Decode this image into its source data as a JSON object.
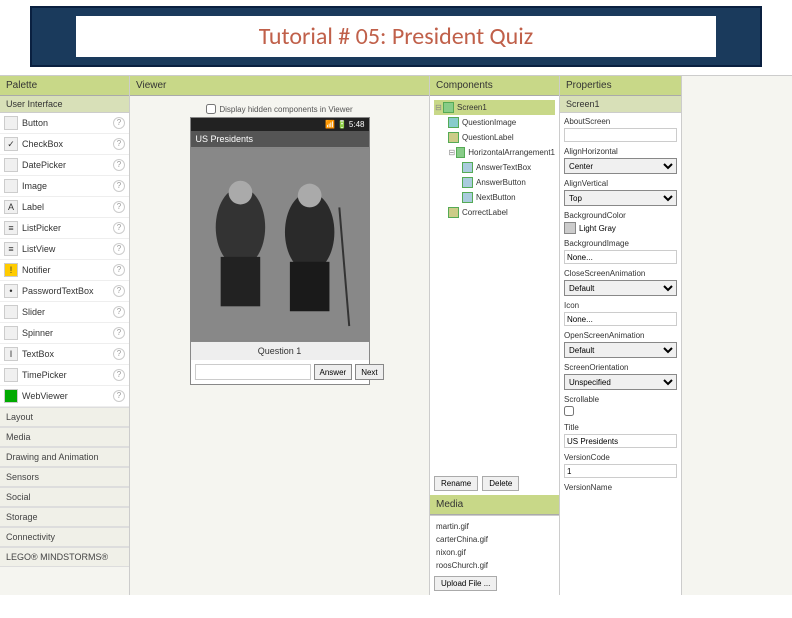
{
  "title": "Tutorial # 05:  President Quiz",
  "palette": {
    "header": "Palette",
    "subheader": "User Interface",
    "items": [
      {
        "label": "Button"
      },
      {
        "label": "CheckBox"
      },
      {
        "label": "DatePicker"
      },
      {
        "label": "Image"
      },
      {
        "label": "Label"
      },
      {
        "label": "ListPicker"
      },
      {
        "label": "ListView"
      },
      {
        "label": "Notifier"
      },
      {
        "label": "PasswordTextBox"
      },
      {
        "label": "Slider"
      },
      {
        "label": "Spinner"
      },
      {
        "label": "TextBox"
      },
      {
        "label": "TimePicker"
      },
      {
        "label": "WebViewer"
      }
    ],
    "categories": [
      "Layout",
      "Media",
      "Drawing and Animation",
      "Sensors",
      "Social",
      "Storage",
      "Connectivity",
      "LEGO® MINDSTORMS®"
    ]
  },
  "viewer": {
    "header": "Viewer",
    "checkbox": "Display hidden components in Viewer",
    "phone_time": "5:48",
    "app_title": "US Presidents",
    "question": "Question 1",
    "answer_btn": "Answer",
    "next_btn": "Next"
  },
  "components": {
    "header": "Components",
    "tree": [
      {
        "label": "Screen1",
        "level": 0,
        "tog": "⊟"
      },
      {
        "label": "QuestionImage",
        "level": 1
      },
      {
        "label": "QuestionLabel",
        "level": 1
      },
      {
        "label": "HorizontalArrangement1",
        "level": 1,
        "tog": "⊟"
      },
      {
        "label": "AnswerTextBox",
        "level": 2
      },
      {
        "label": "AnswerButton",
        "level": 2
      },
      {
        "label": "NextButton",
        "level": 2
      },
      {
        "label": "CorrectLabel",
        "level": 1
      }
    ],
    "rename": "Rename",
    "delete": "Delete",
    "media_header": "Media",
    "media": [
      "martin.gif",
      "carterChina.gif",
      "nixon.gif",
      "roosChurch.gif"
    ],
    "upload": "Upload File ..."
  },
  "properties": {
    "header": "Properties",
    "selected": "Screen1",
    "props": {
      "AboutScreen": {
        "label": "AboutScreen",
        "value": ""
      },
      "AlignHorizontal": {
        "label": "AlignHorizontal",
        "value": "Center"
      },
      "AlignVertical": {
        "label": "AlignVertical",
        "value": "Top"
      },
      "BackgroundColor": {
        "label": "BackgroundColor",
        "value": "Light Gray"
      },
      "BackgroundImage": {
        "label": "BackgroundImage",
        "value": "None..."
      },
      "CloseScreenAnimation": {
        "label": "CloseScreenAnimation",
        "value": "Default"
      },
      "Icon": {
        "label": "Icon",
        "value": "None..."
      },
      "OpenScreenAnimation": {
        "label": "OpenScreenAnimation",
        "value": "Default"
      },
      "ScreenOrientation": {
        "label": "ScreenOrientation",
        "value": "Unspecified"
      },
      "Scrollable": {
        "label": "Scrollable"
      },
      "Title": {
        "label": "Title",
        "value": "US Presidents"
      },
      "VersionCode": {
        "label": "VersionCode",
        "value": "1"
      },
      "VersionName": {
        "label": "VersionName"
      }
    }
  }
}
